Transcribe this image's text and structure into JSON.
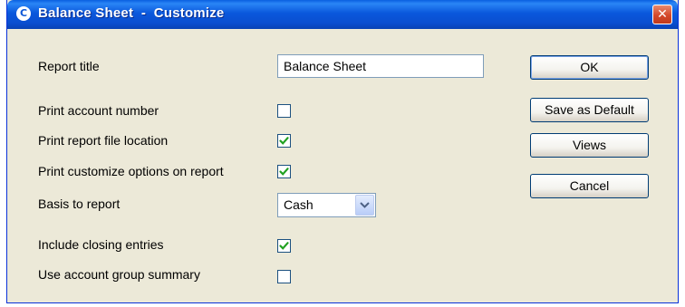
{
  "window": {
    "title": "Balance Sheet  -  Customize",
    "app_icon_glyph": "C",
    "close_glyph": "✕"
  },
  "fields": {
    "report_title_label": "Report title",
    "report_title_value": "Balance Sheet",
    "print_account_number_label": "Print account number",
    "print_account_number_checked": false,
    "print_report_file_location_label": "Print report file location",
    "print_report_file_location_checked": true,
    "print_customize_options_label": "Print customize options on report",
    "print_customize_options_checked": true,
    "basis_label": "Basis to report",
    "basis_value": "Cash",
    "include_closing_entries_label": "Include closing entries",
    "include_closing_entries_checked": true,
    "use_account_group_summary_label": "Use account group summary",
    "use_account_group_summary_checked": false
  },
  "buttons": {
    "ok": "OK",
    "save_default": "Save as Default",
    "views": "Views",
    "cancel": "Cancel"
  },
  "colors": {
    "titlebar": "#0a58dc",
    "dialog_bg": "#ece9d8",
    "check": "#21a121"
  }
}
